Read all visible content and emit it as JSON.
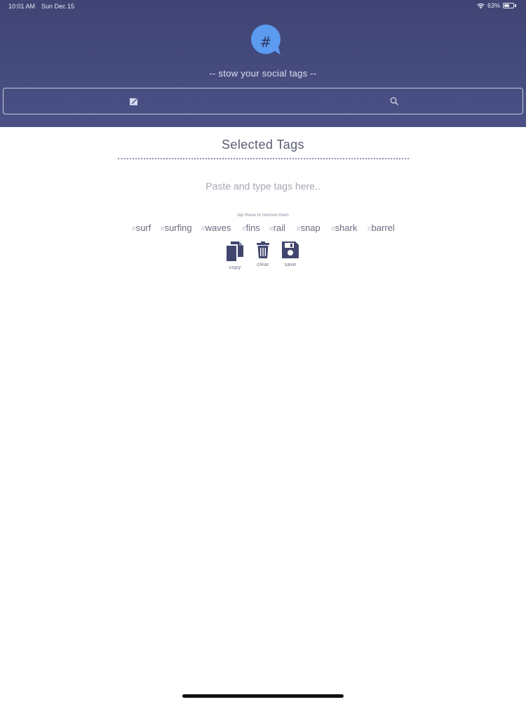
{
  "status_bar": {
    "time": "10:01 AM",
    "date": "Sun Dec 15",
    "battery": "63%",
    "battery_level": 0.63,
    "wifi_icon": "wifi-icon",
    "battery_icon": "battery-icon"
  },
  "header": {
    "logo_icon": "hashtag-speech-bubble-icon",
    "tagline": "-- stow your social tags --",
    "tabs": [
      {
        "name": "compose",
        "icon": "compose-icon"
      },
      {
        "name": "search",
        "icon": "search-icon"
      }
    ]
  },
  "main": {
    "title": "Selected Tags",
    "input_placeholder": "Paste and type tags here..",
    "hint": "tap these to remove them",
    "tags": [
      "surf",
      "surfing",
      "waves",
      "fins",
      "rail",
      "snap",
      "shark",
      "barrel"
    ],
    "hash_symbol": "#",
    "actions": [
      {
        "label": "copy",
        "icon": "copy-icon"
      },
      {
        "label": "clear",
        "icon": "trash-icon"
      },
      {
        "label": "save",
        "icon": "floppy-disk-icon"
      }
    ]
  },
  "colors": {
    "header_bg": "#454b7c",
    "accent_blue": "#5b9bf0",
    "icon_navy": "#41466f"
  }
}
